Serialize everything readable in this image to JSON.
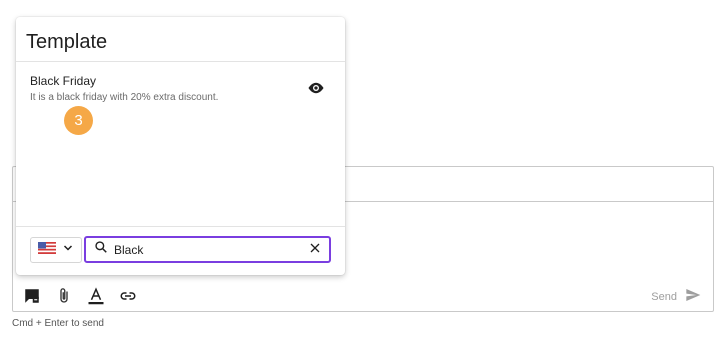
{
  "template_popup": {
    "title": "Template",
    "items": [
      {
        "title": "Black Friday",
        "description": "It is a black friday with 20% extra discount.",
        "preview_icon": "eye-icon"
      }
    ],
    "step_badge": "3",
    "country_select": {
      "icon": "us-flag-icon",
      "chevron": "chevron-down-icon"
    },
    "search": {
      "value": "Black",
      "icon": "search-icon",
      "clear_icon": "close-icon"
    }
  },
  "composer": {
    "toolbar_icons": [
      "template-icon",
      "attachment-icon",
      "text-format-icon",
      "link-icon"
    ],
    "send_label": "Send",
    "send_icon": "send-icon"
  },
  "hint": "Cmd + Enter to send",
  "colors": {
    "accent": "#7a3ee0",
    "badge": "#f5a847"
  }
}
